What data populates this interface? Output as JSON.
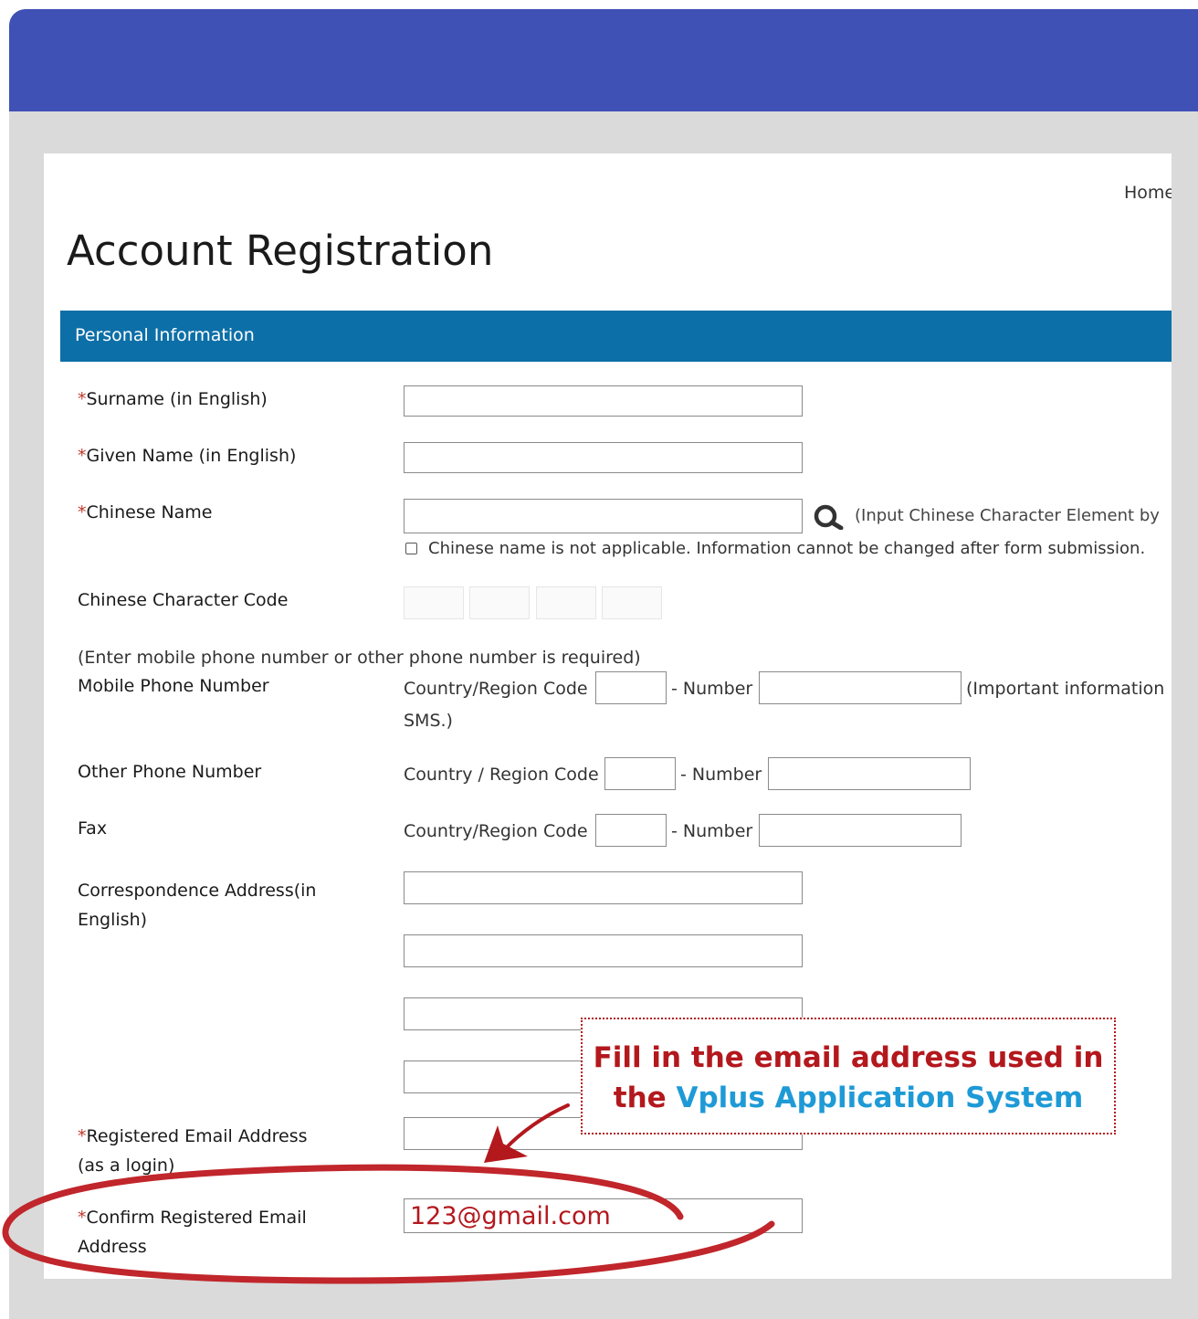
{
  "colors": {
    "banner": "#3f51b5",
    "section_bar": "#0d6fa7",
    "required_mark": "#c0392b",
    "annotation_red": "#b3181d",
    "annotation_blue": "#1e9ad6"
  },
  "nav": {
    "home": "Home"
  },
  "page": {
    "title": "Account Registration"
  },
  "section": {
    "title": "Personal Information"
  },
  "required_mark": "*",
  "fields": {
    "surname": "Surname (in English)",
    "given_name": "Given Name (in English)",
    "chinese_name": "Chinese Name",
    "chinese_name_hint": "(Input Chinese Character Element by",
    "chinese_na": "Chinese name is not applicable. Information cannot be changed after form submission.",
    "char_code": "Chinese Character Code",
    "phone_note": "(Enter mobile phone number or other phone number is required)",
    "mobile": "Mobile Phone Number",
    "other_phone": "Other Phone Number",
    "fax": "Fax",
    "address_line1": "Correspondence Address(in",
    "address_line2": "English)",
    "email_line1": "Registered Email Address",
    "email_line2": "(as a login)",
    "confirm_line1": "Confirm Registered Email",
    "confirm_line2": "Address"
  },
  "phone": {
    "code_label": "Country/Region Code",
    "code_label_alt": "Country / Region Code",
    "number_label": "- Number",
    "important_note": "(Important information",
    "sms": "SMS.)"
  },
  "inputs": {
    "confirm_email_value": "123@gmail.com"
  },
  "callout": {
    "line1": "Fill in the email address used in",
    "line2_prefix": "the ",
    "line2_highlight": "Vplus Application System"
  },
  "icons": {
    "search": "search-icon"
  }
}
